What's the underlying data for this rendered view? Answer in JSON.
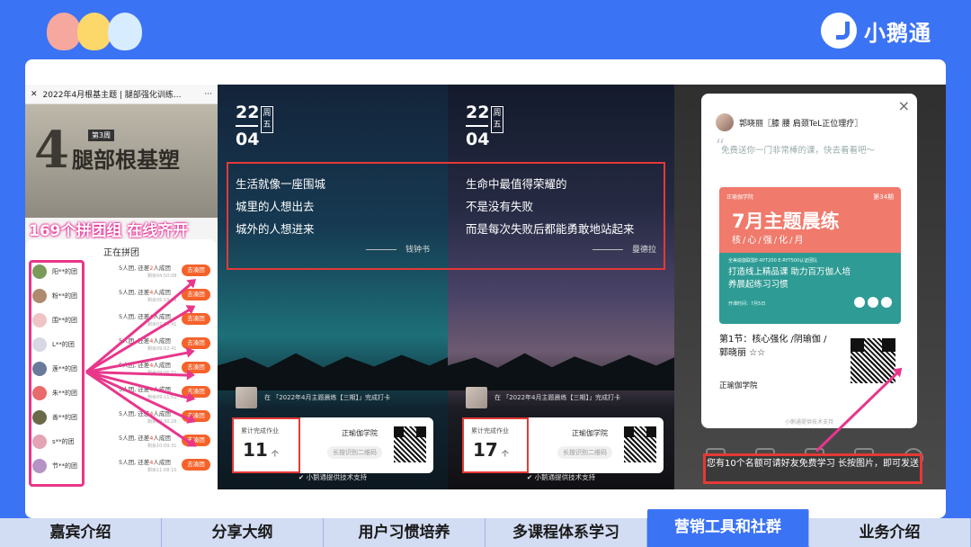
{
  "brand": {
    "name": "小鹅通"
  },
  "left_phone": {
    "header_title": "2022年4月根基主题 | 腿部强化训练...",
    "menu": "···",
    "hero_big": "4",
    "hero_sub": "腿部根基塑",
    "hero_week": "第3周",
    "banner": "169个拼团组 在线齐开",
    "list_title": "正在拼团",
    "join_label": "去凑团",
    "groups": [
      {
        "name": "阳**的团",
        "info_prefix": "5人团, 还差",
        "info_num": "2",
        "info_suffix": "人成团",
        "time": "剩余04:50:08",
        "color": "#7a9a5a"
      },
      {
        "name": "粉**的团",
        "info_prefix": "5人团, 还差",
        "info_num": "4",
        "info_suffix": "人成团",
        "time": "剩余05:10:48",
        "color": "#b08a6c"
      },
      {
        "name": "围**的团",
        "info_prefix": "5人团, 还差",
        "info_num": "4",
        "info_suffix": "人成团",
        "time": "剩余07:18:41",
        "color": "#f0c4c4"
      },
      {
        "name": "L**的团",
        "info_prefix": "5人团, 还差",
        "info_num": "4",
        "info_suffix": "人成团",
        "time": "剩余09:02:41",
        "color": "#d8d8e4"
      },
      {
        "name": "莲**的团",
        "info_prefix": "5人团, 还差",
        "info_num": "4",
        "info_suffix": "人成团",
        "time": "剩余09:06:51",
        "color": "#6a7a9a"
      },
      {
        "name": "朱**的团",
        "info_prefix": "5人团, 还差",
        "info_num": "4",
        "info_suffix": "人成团",
        "time": "剩余09:11:51",
        "color": "#e86a6a"
      },
      {
        "name": "善**的团",
        "info_prefix": "5人团, 还差",
        "info_num": "4",
        "info_suffix": "人成团",
        "time": "剩余09:30:29",
        "color": "#6a6a4a"
      },
      {
        "name": "s**的团",
        "info_prefix": "5人团, 还差",
        "info_num": "4",
        "info_suffix": "人成团",
        "time": "剩余10:09:31",
        "color": "#e4a4b4"
      },
      {
        "name": "节**的团",
        "info_prefix": "5人团, 还差",
        "info_num": "4",
        "info_suffix": "人成团",
        "time": "剩余11:08:10",
        "color": "#b494c4"
      }
    ]
  },
  "card1": {
    "day": "22",
    "month": "04",
    "weekday": "周五",
    "quote": [
      "生活就像一座围城",
      "城里的人想出去",
      "城外的人想进来"
    ],
    "author": "钱钟书",
    "user_text": "在 「2022年4月主题晨练【三期】」完成打卡",
    "stat_label": "累计完成作业",
    "stat_num": "11",
    "stat_unit": "个",
    "school": "正瑜伽学院",
    "scan": "长按识别二维码",
    "powered": "小鹅通提供技术支持"
  },
  "card2": {
    "day": "22",
    "month": "04",
    "weekday": "周五",
    "quote": [
      "生命中最值得荣耀的",
      "不是没有失败",
      "而是每次失败后都能勇敢地站起来"
    ],
    "author": "曼德拉",
    "user_text": "在 「2022年4月主题晨练【三期】」完成打卡",
    "stat_label": "累计完成作业",
    "stat_num": "17",
    "stat_unit": "个",
    "school": "正瑜伽学院",
    "scan": "长按识别二维码",
    "powered": "小鹅通提供技术支持"
  },
  "popup": {
    "user": "郭晓丽〖膝 腰 肩颈TeL正位理疗〗",
    "close": "×",
    "quote_mark": "“",
    "quote": "免费送你一门非常棒的课，快去看看吧～",
    "poster_brand": "正瑜伽学院",
    "poster_no": "第34期",
    "poster_title": "7月主题晨练",
    "poster_sub": "核/心/强/化/月",
    "poster_small": "全美瑜伽联盟E-RYT200 E-RYT500认证团队",
    "poster_slogan": "打造线上精品课 助力百万伽人培养晨起练习习惯",
    "poster_date": "开课时间：7月5日",
    "lesson": "第1节：核心强化 /阴瑜伽 /郭晓丽 ☆☆",
    "school": "正瑜伽学院",
    "powered": "小鹅通提供技术支持",
    "invite": "您有10个名额可请好友免费学习 长按图片，即可发送"
  },
  "tabs": [
    {
      "label": "嘉宾介绍",
      "active": false
    },
    {
      "label": "分享大纲",
      "active": false
    },
    {
      "label": "用户习惯培养",
      "active": false
    },
    {
      "label": "多课程体系学习",
      "active": false
    },
    {
      "label": "营销工具和社群",
      "active": true
    },
    {
      "label": "业务介绍",
      "active": false
    }
  ],
  "colors": {
    "brand_blue": "#3b73f5",
    "highlight_pink": "#e8368b",
    "highlight_red": "#e53935",
    "join_orange": "#f5622a"
  }
}
